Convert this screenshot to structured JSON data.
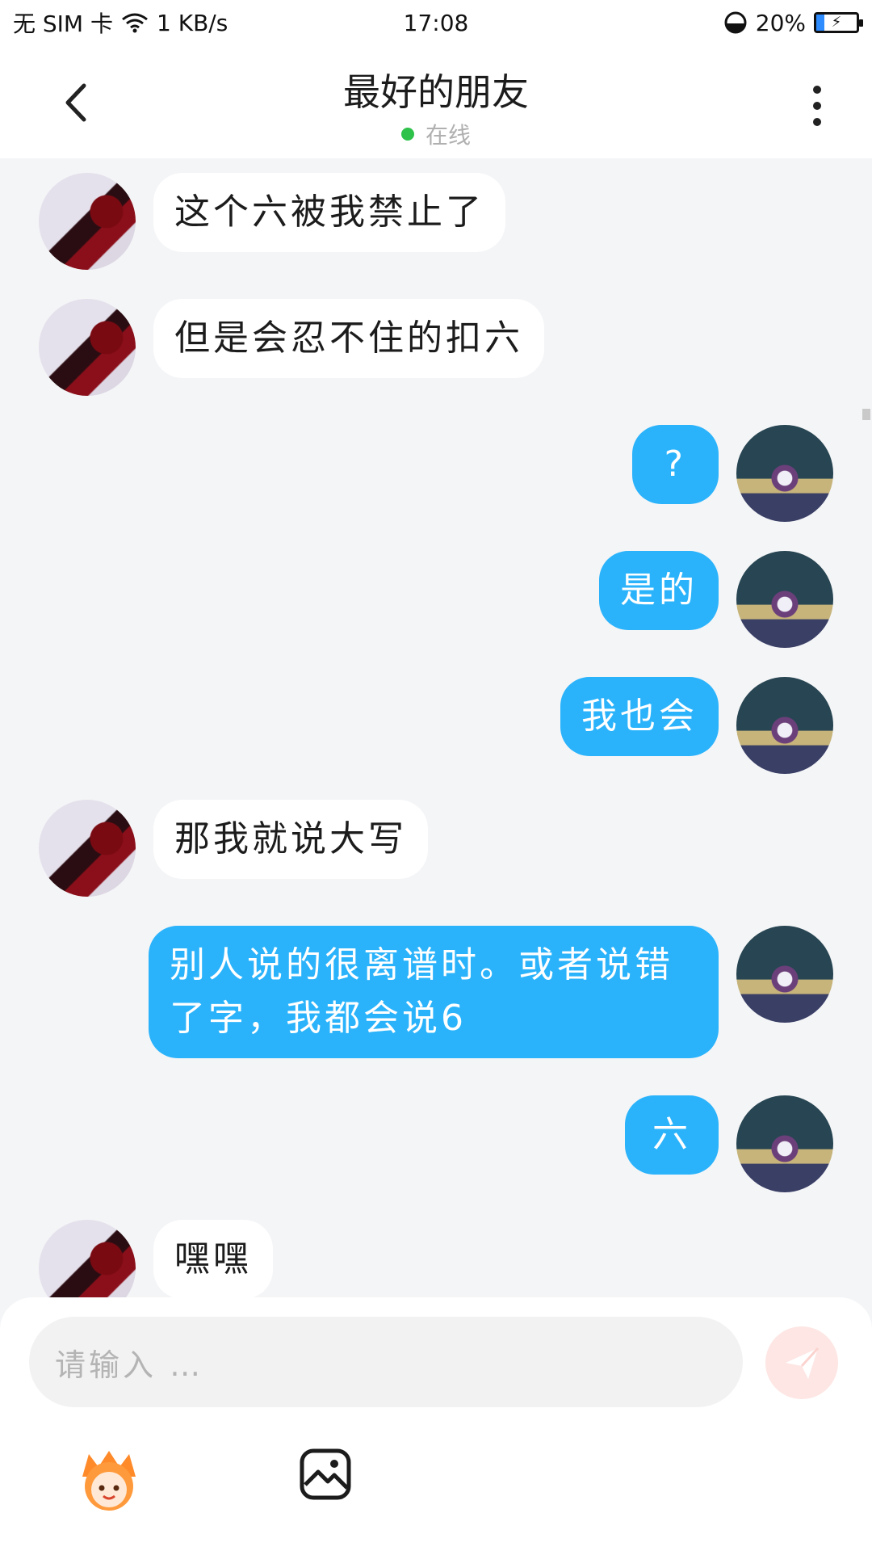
{
  "status_bar": {
    "sim": "无 SIM 卡",
    "speed": "1 KB/s",
    "time": "17:08",
    "battery": "20%",
    "battery_level": 0.2
  },
  "header": {
    "title": "最好的朋友",
    "status": "在线"
  },
  "messages": [
    {
      "side": "in",
      "text": "这个六被我禁止了"
    },
    {
      "side": "in",
      "text": "但是会忍不住的扣六"
    },
    {
      "side": "out",
      "text": "?"
    },
    {
      "side": "out",
      "text": "是的"
    },
    {
      "side": "out",
      "text": "我也会"
    },
    {
      "side": "in",
      "text": "那我就说大写"
    },
    {
      "side": "out",
      "text": "别人说的很离谱时。或者说错了字，我都会说6"
    },
    {
      "side": "out",
      "text": "六"
    },
    {
      "side": "in",
      "text": "嘿嘿"
    }
  ],
  "composer": {
    "placeholder": "请输入 …"
  },
  "icons": {
    "back": "chevron-left-icon",
    "more": "more-vertical-icon",
    "send": "send-icon",
    "emoji": "emoji-icon",
    "image": "image-icon"
  },
  "colors": {
    "outgoing_bubble": "#2ab3fb",
    "incoming_bubble": "#ffffff",
    "online_dot": "#2ec24a",
    "send_button": "#fde6e4"
  }
}
